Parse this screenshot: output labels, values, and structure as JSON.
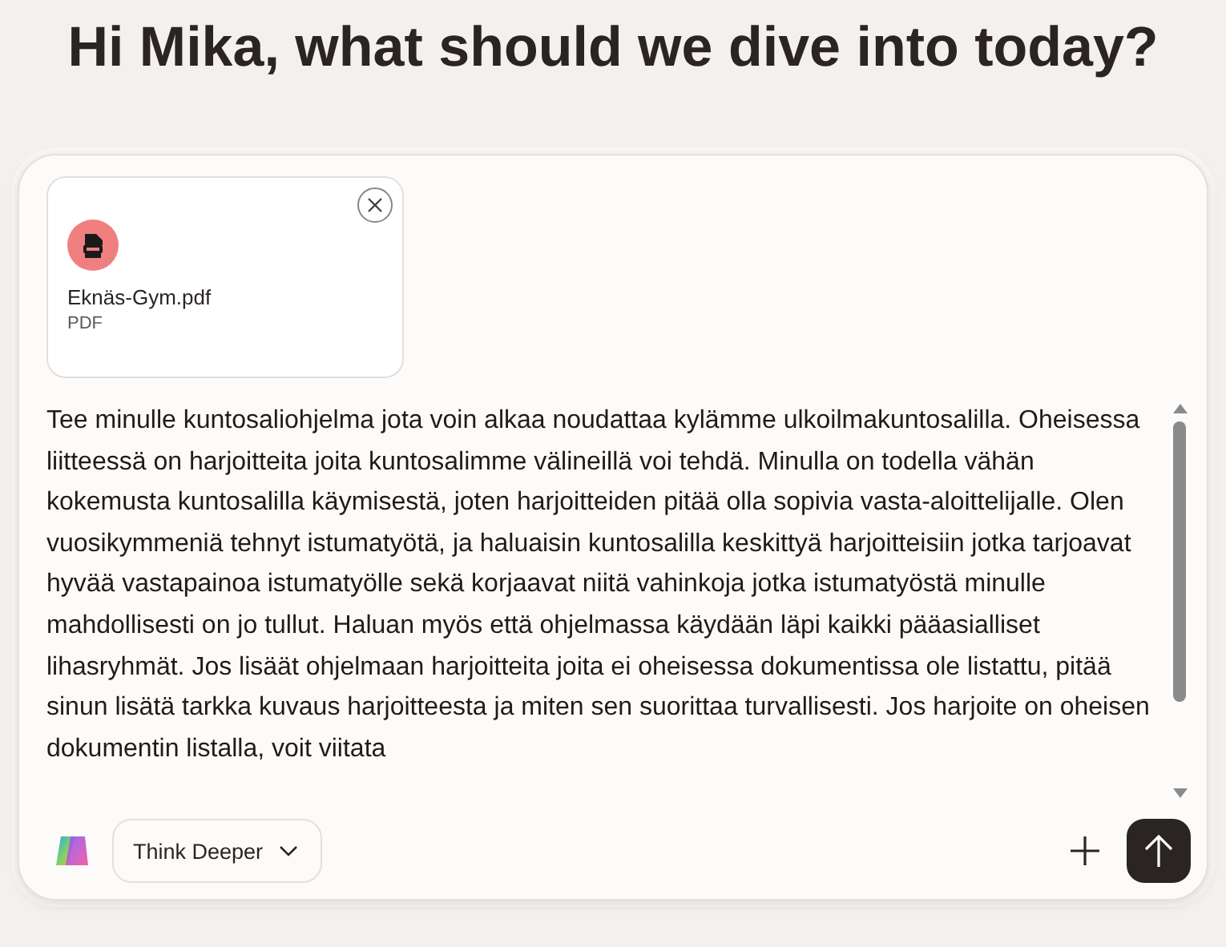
{
  "heading": "Hi Mika, what should we dive into today?",
  "attachment": {
    "file_name": "Eknäs-Gym.pdf",
    "file_type": "PDF"
  },
  "prompt": {
    "value": "Tee minulle kuntosaliohjelma jota voin alkaa noudattaa kylämme ulkoilmakuntosalilla. Oheisessa liitteessä on harjoitteita joita kuntosalimme välineillä voi tehdä. Minulla on todella vähän kokemusta kuntosalilla käymisestä, joten harjoitteiden pitää olla sopivia vasta-aloittelijalle. Olen vuosikymmeniä tehnyt istumatyötä, ja haluaisin kuntosalilla keskittyä harjoitteisiin jotka tarjoavat hyvää vastapainoa istumatyölle sekä korjaavat niitä vahinkoja jotka istumatyöstä minulle mahdollisesti on jo tullut. Haluan myös että ohjelmassa käydään läpi kaikki pääasialliset lihasryhmät. Jos lisäät ohjelmaan harjoitteita joita ei oheisessa dokumentissa ole listattu, pitää sinun lisätä tarkka kuvaus harjoitteesta ja miten sen suorittaa turvallisesti. Jos harjoite on oheisen dokumentin listalla, voit viitata"
  },
  "mode_selector": {
    "label": "Think Deeper"
  }
}
